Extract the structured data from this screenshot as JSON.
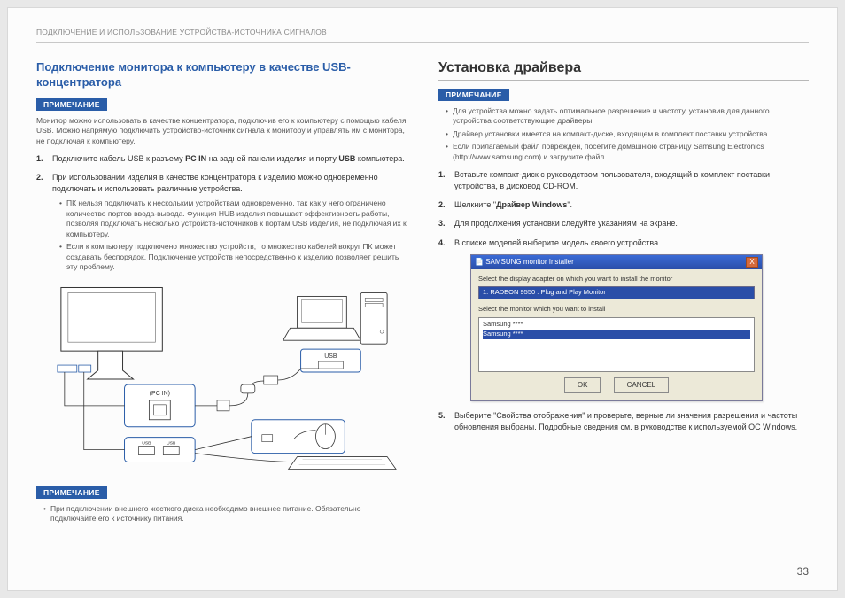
{
  "breadcrumb": "Подключение и использование устройства-источника сигналов",
  "page_number": "33",
  "left": {
    "title": "Подключение монитора к компьютеру в качестве USB-концентратора",
    "note_label": "ПРИМЕЧАНИЕ",
    "intro": "Монитор можно использовать в качестве концентратора, подключив его к компьютеру с помощью кабеля USB. Можно напрямую подключить устройство-источник сигнала к монитору и управлять им с монитора, не подключая к компьютеру.",
    "step1_a": "Подключите кабель USB к разъему ",
    "step1_b": "PC IN",
    "step1_c": " на задней панели изделия и порту ",
    "step1_d": "USB",
    "step1_e": " компьютера.",
    "step2": "При использовании изделия в качестве концентратора к изделию можно одновременно подключать и использовать различные устройства.",
    "sub_bullets": [
      "ПК нельзя подключать к нескольким устройствам одновременно, так как у него ограничено количество портов ввода-вывода. Функция HUB изделия повышает эффективность работы, позволяя подключать несколько устройств-источников к портам USB изделия, не подключая их к компьютеру.",
      "Если к компьютеру подключено множество устройств, то множество кабелей вокруг ПК может создавать беспорядок. Подключение устройств непосредственно к изделию позволяет решить эту проблему."
    ],
    "diagram_labels": {
      "pc_in": "(PC IN)",
      "usb": "USB",
      "usb_small": "USB"
    },
    "note2_label": "ПРИМЕЧАНИЕ",
    "note2_bullet": "При подключении внешнего жесткого диска необходимо внешнее питание. Обязательно подключайте его к источнику питания."
  },
  "right": {
    "title": "Установка драйвера",
    "note_label": "ПРИМЕЧАНИЕ",
    "bullets": [
      "Для устройства можно задать оптимальное разрешение и частоту, установив для данного устройства соответствующие драйверы.",
      "Драйвер установки имеется на компакт-диске, входящем в комплект поставки устройства.",
      "Если прилагаемый файл поврежден, посетите домашнюю страницу Samsung Electronics (http://www.samsung.com) и загрузите файл."
    ],
    "step1": "Вставьте компакт-диск с руководством пользователя, входящий в комплект поставки устройства, в дисковод CD-ROM.",
    "step2_a": "Щелкните \"",
    "step2_b": "Драйвер Windows",
    "step2_c": "\".",
    "step3": "Для продолжения установки следуйте указаниям на экране.",
    "step4": "В списке моделей выберите модель своего устройства.",
    "step5": "Выберите \"Свойства отображения\" и проверьте, верные ли значения разрешения и частоты обновления выбраны. Подробные сведения см. в руководстве к используемой ОС Windows.",
    "installer": {
      "title": "SAMSUNG monitor Installer",
      "close": "X",
      "lbl1": "Select the display adapter on which you want to install the monitor",
      "drop": "1. RADEON 9550 : Plug and Play Monitor",
      "lbl2": "Select the monitor which you want to install",
      "list1": "Samsung ****",
      "list2": "Samsung ****",
      "ok": "OK",
      "cancel": "CANCEL"
    }
  }
}
